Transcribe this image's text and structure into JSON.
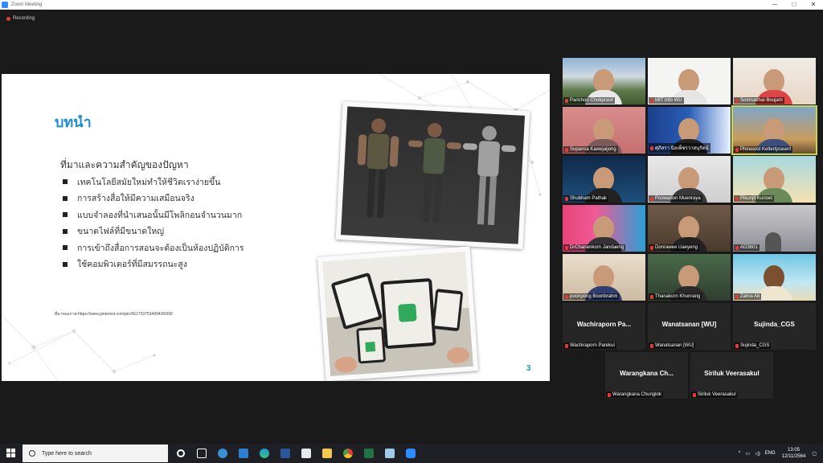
{
  "window": {
    "title": "Zoom Meeting"
  },
  "recording": {
    "label": "Recording"
  },
  "slide": {
    "title": "บทนำ",
    "subtitle": "ที่มาและความสำคัญของปัญหา",
    "bullets": [
      "เทคโนโลยีสมัยใหม่ทำให้ชีวิตเราง่ายขึ้น",
      "การสร้างสื่อให้มีความเสมือนจริง",
      "แบบจำลองที่นำเสนอนั้นมีโพลิกอนจำนวนมาก",
      "ขนาดไฟล์ที่มีขนาดใหญ่",
      "การเข้าถึงสื่อการสอนจะต้องเป็นห้องปฏิบัติการ",
      "ใช้คอมพิวเตอร์ที่มีสมรรถนะสูง"
    ],
    "source": "ที่มาของภาพ https://www.pinterest.com/pin/561753753499426009/",
    "page_number": "3"
  },
  "participants": [
    {
      "name": "Parichon Chokprasit"
    },
    {
      "name": "MIT Info WU"
    },
    {
      "name": "Somruethai Boujam"
    },
    {
      "name": "Supansa Kaewjaijong"
    },
    {
      "name": "ศุภิสรา นิลเพ็ชรวาสนุรัตน์"
    },
    {
      "name": "Phirasoot Keltertprasert"
    },
    {
      "name": "Shubham Pathak"
    },
    {
      "name": "Poowadon Muenraya"
    },
    {
      "name": "Pikunjit Kunoet"
    },
    {
      "name": "DrChanankorn Jandaeng"
    },
    {
      "name": "Donrawee Uaeyeng"
    },
    {
      "name": "AD3601"
    },
    {
      "name": "poonpong Boonbrahm"
    },
    {
      "name": "Thanakorn Khunrang"
    },
    {
      "name": "Zahra Ab"
    }
  ],
  "novideo": [
    {
      "big": "Wachiraporn  Pa...",
      "name": "Wachiraporn Parekul"
    },
    {
      "big": "Wanatsanan [WU]",
      "name": "Wanatsanan [WU]"
    },
    {
      "big": "Sujinda_CGS",
      "name": "Sujinda_CGS"
    },
    {
      "big": "Warangkana  Ch...",
      "name": "Warangkana Chunglok"
    },
    {
      "big": "Siriluk Veerasakul",
      "name": "Siriluk Veerasakul"
    }
  ],
  "taskbar": {
    "search_placeholder": "Type here to search",
    "lang": "ENG",
    "time": "13:05",
    "date": "12/11/2564"
  }
}
